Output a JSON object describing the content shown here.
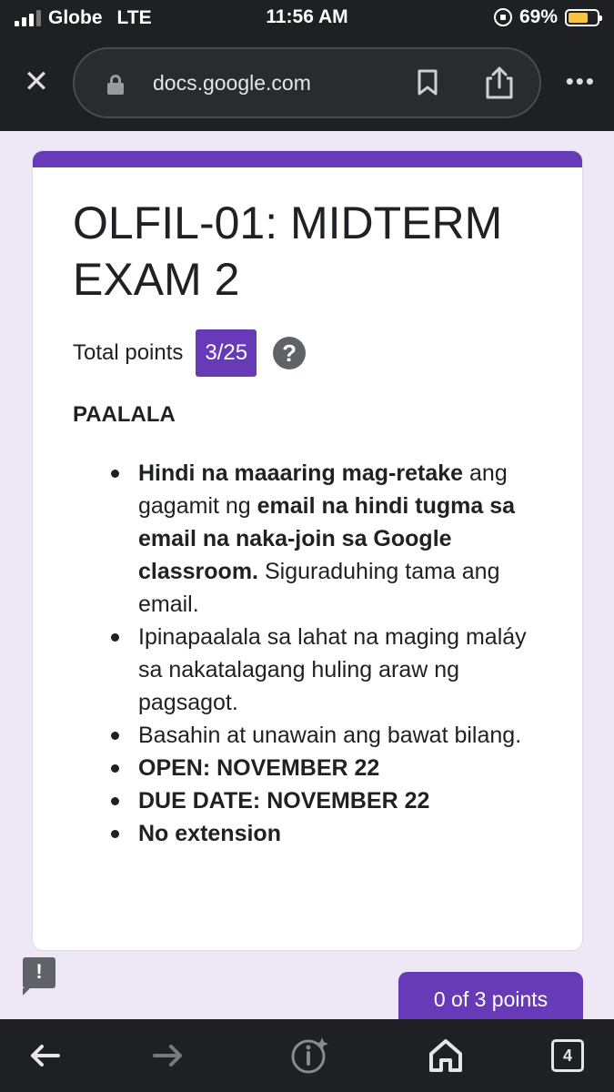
{
  "status_bar": {
    "carrier": "Globe",
    "network": "LTE",
    "time": "11:56 AM",
    "battery": "69%",
    "battery_level": 0.69,
    "battery_color": "#f5c542"
  },
  "browser": {
    "url": "docs.google.com",
    "icons": [
      "close-icon",
      "lock-icon",
      "bookmark-icon",
      "share-icon",
      "more-icon"
    ],
    "tab_count": "4"
  },
  "form": {
    "accent_color": "#673ab7",
    "title": "OLFIL-01: MIDTERM EXAM 2",
    "total_points_label": "Total points",
    "score": "3/25",
    "section_heading": "PAALALA",
    "bullets": [
      {
        "parts": [
          {
            "text": "Hindi na maaaring mag-retake",
            "bold": true
          },
          {
            "text": " ang gagamit ng ",
            "bold": false
          },
          {
            "text": "email na hindi tugma sa email na naka-join sa Google classroom.",
            "bold": true
          },
          {
            "text": " Siguraduhing tama ang email.",
            "bold": false
          }
        ]
      },
      {
        "parts": [
          {
            "text": "Ipinapaalala sa lahat na maging maláy sa nakatalagang huling araw ng pagsagot.",
            "bold": false
          }
        ]
      },
      {
        "parts": [
          {
            "text": "Basahin at unawain ang bawat bilang.",
            "bold": false
          }
        ]
      },
      {
        "parts": [
          {
            "text": "OPEN: NOVEMBER 22",
            "bold": true
          }
        ]
      },
      {
        "parts": [
          {
            "text": "DUE DATE: NOVEMBER 22",
            "bold": true
          }
        ]
      },
      {
        "parts": [
          {
            "text": "No extension",
            "bold": true
          }
        ]
      }
    ],
    "points_chip": "0 of 3 points"
  },
  "toolbar": {
    "icons": [
      "back-arrow-icon",
      "forward-arrow-icon",
      "info-sparkle-icon",
      "home-icon",
      "tabs-icon"
    ]
  }
}
